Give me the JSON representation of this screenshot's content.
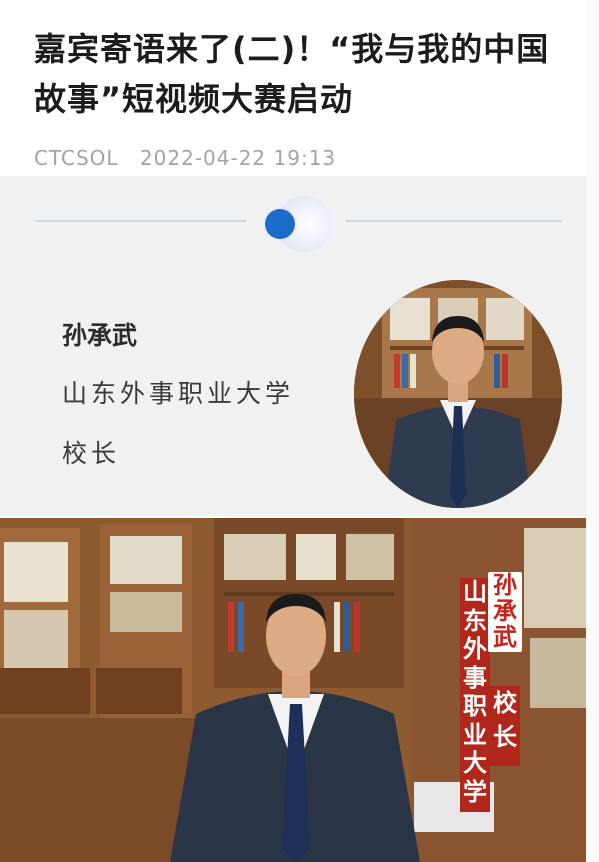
{
  "article": {
    "title": "嘉宾寄语来了(二)！“我与我的中国故事”短视频大赛启动",
    "source": "CTCSOL",
    "datetime": "2022-04-22 19:13"
  },
  "guest": {
    "name": "孙承武",
    "organization": "山东外事职业大学",
    "position": "校长"
  },
  "video_caption": {
    "name_chars": [
      "孙",
      "承",
      "武"
    ],
    "org_chars": [
      "山",
      "东",
      "外",
      "事",
      "职",
      "业",
      "大",
      "学"
    ],
    "role_chars": [
      "校",
      "长"
    ]
  },
  "colors": {
    "accent_blue": "#1c6cc9",
    "caption_red": "#b2271b",
    "name_red": "#c5231b",
    "wood": "#8e5a30"
  }
}
